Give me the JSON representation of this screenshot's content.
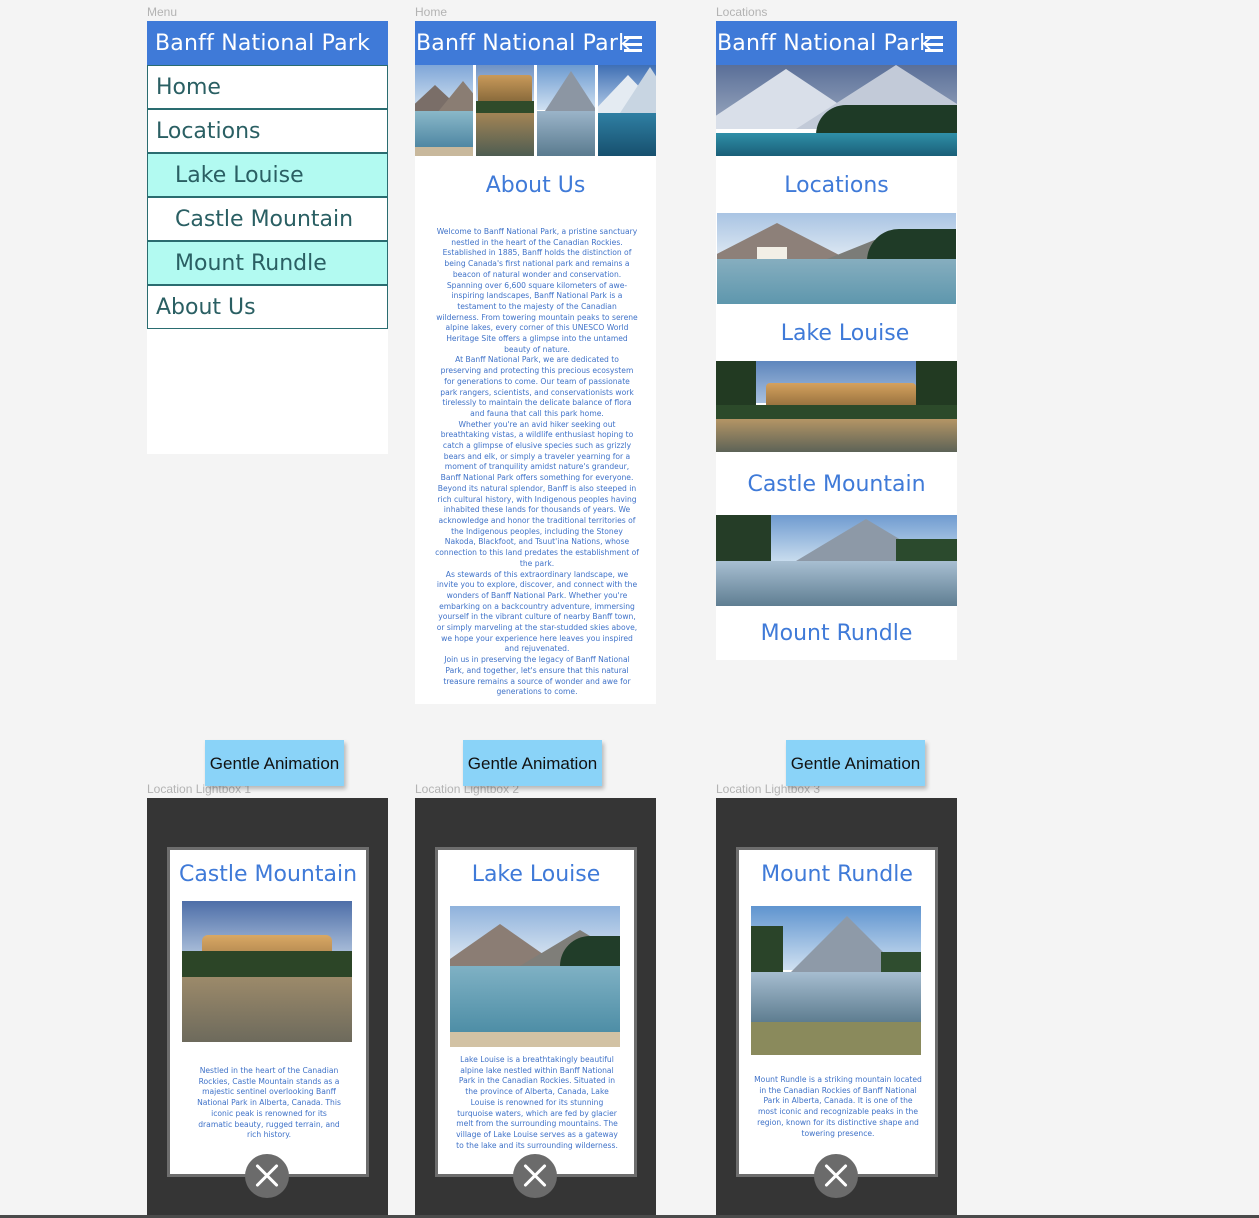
{
  "frames": {
    "menu": "Menu",
    "home": "Home",
    "locations": "Locations",
    "lightbox1": "Location Lightbox 1",
    "lightbox2": "Location Lightbox 2",
    "lightbox3": "Location Lightbox 3"
  },
  "app_title": "Banff National Park",
  "menu": {
    "home": "Home",
    "locations": "Locations",
    "lake_louise": "Lake Louise",
    "castle_mountain": "Castle Mountain",
    "mount_rundle": "Mount Rundle",
    "about_us": "About Us"
  },
  "home": {
    "heading": "About Us",
    "paragraphs": [
      "Welcome to Banff National Park, a pristine sanctuary nestled in the heart of the Canadian Rockies. Established in 1885, Banff holds the distinction of being Canada's first national park and remains a beacon of natural wonder and conservation. Spanning over 6,600 square kilometers of awe-inspiring landscapes, Banff National Park is a testament to the majesty of the Canadian wilderness. From towering mountain peaks to serene alpine lakes, every corner of this UNESCO World Heritage Site offers a glimpse into the untamed beauty of nature.",
      "At Banff National Park, we are dedicated to preserving and protecting this precious ecosystem for generations to come. Our team of passionate park rangers, scientists, and conservationists work tirelessly to maintain the delicate balance of flora and fauna that call this park home.",
      "Whether you're an avid hiker seeking out breathtaking vistas, a wildlife enthusiast hoping to catch a glimpse of elusive species such as grizzly bears and elk, or simply a traveler yearning for a moment of tranquility amidst nature's grandeur, Banff National Park offers something for everyone. Beyond its natural splendor, Banff is also steeped in rich cultural history, with Indigenous peoples having inhabited these lands for thousands of years. We acknowledge and honor the traditional territories of the Indigenous peoples, including the Stoney Nakoda, Blackfoot, and Tsuut'ina Nations, whose connection to this land predates the establishment of the park.",
      "As stewards of this extraordinary landscape, we invite you to explore, discover, and connect with the wonders of Banff National Park. Whether you're embarking on a backcountry adventure, immersing yourself in the vibrant culture of nearby Banff town, or simply marveling at the star-studded skies above, we hope your experience here leaves you inspired and rejuvenated.",
      "Join us in preserving the legacy of Banff National Park, and together, let's ensure that this natural treasure remains a source of wonder and awe for generations to come."
    ]
  },
  "locations": {
    "heading": "Locations",
    "lake_louise": "Lake Louise",
    "castle_mountain": "Castle Mountain",
    "mount_rundle": "Mount Rundle"
  },
  "notes": {
    "label": "Gentle Animation"
  },
  "lightboxes": {
    "castle": {
      "title": "Castle Mountain",
      "text": "Nestled in the heart of the Canadian Rockies, Castle Mountain stands as a majestic sentinel overlooking Banff National Park in Alberta, Canada. This iconic peak is renowned for its dramatic beauty, rugged terrain, and rich history."
    },
    "lake": {
      "title": "Lake Louise",
      "text": "Lake Louise is a breathtakingly beautiful alpine lake nestled within Banff National Park in the Canadian Rockies. Situated in the province of Alberta, Canada, Lake Louise is renowned for its stunning turquoise waters, which are fed by glacier melt from the surrounding mountains. The village of Lake Louise serves as a gateway to the lake and its surrounding wilderness."
    },
    "rundle": {
      "title": "Mount Rundle",
      "text": "Mount Rundle is a striking mountain located in the Canadian Rockies of Banff National Park in Alberta, Canada. It is one of the most iconic and recognizable peaks in the region, known for its distinctive shape and towering presence."
    }
  },
  "colors": {
    "appbar": "#3f7ad8",
    "menu_highlight": "#b2faf1",
    "note": "#8ad3f8",
    "lightbox_backdrop": "#353535"
  },
  "icons": {
    "menu": "hamburger-icon",
    "close": "close-icon"
  }
}
